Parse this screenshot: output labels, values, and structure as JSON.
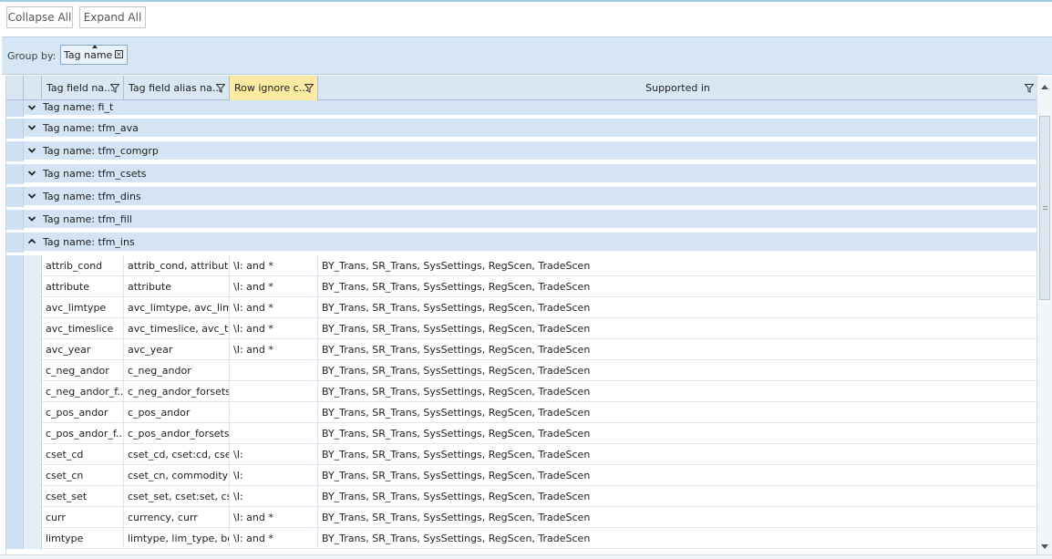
{
  "toolbar": {
    "collapse_all": "Collapse All",
    "expand_all": "Expand All"
  },
  "group_panel": {
    "label": "Group by:",
    "chip_label": "Tag name",
    "chip_close_glyph": "×"
  },
  "columns": [
    {
      "label": "Tag field na...",
      "filter_icon": "filter-icon"
    },
    {
      "label": "Tag field alias na...",
      "filter_icon": "filter-icon"
    },
    {
      "label": "Row ignore c...",
      "filter_icon": "filter-icon",
      "highlighted": true
    },
    {
      "label": "Supported in",
      "filter_icon": "filter-icon"
    }
  ],
  "groups": [
    {
      "label": "Tag name: fi_t",
      "expanded": false
    },
    {
      "label": "Tag name: tfm_ava",
      "expanded": false
    },
    {
      "label": "Tag name: tfm_comgrp",
      "expanded": false
    },
    {
      "label": "Tag name: tfm_csets",
      "expanded": false
    },
    {
      "label": "Tag name: tfm_dins",
      "expanded": false
    },
    {
      "label": "Tag name: tfm_fill",
      "expanded": false
    },
    {
      "label": "Tag name: tfm_ins",
      "expanded": true
    }
  ],
  "rows": [
    [
      "attrib_cond",
      "attrib_cond, attribut...",
      "\\I: and *",
      "BY_Trans, SR_Trans, SysSettings, RegScen, TradeScen"
    ],
    [
      "attribute",
      "attribute",
      "\\I: and *",
      "BY_Trans, SR_Trans, SysSettings, RegScen, TradeScen"
    ],
    [
      "avc_limtype",
      "avc_limtype, avc_lim...",
      "\\I: and *",
      "BY_Trans, SR_Trans, SysSettings, RegScen, TradeScen"
    ],
    [
      "avc_timeslice",
      "avc_timeslice, avc_ti...",
      "\\I: and *",
      "BY_Trans, SR_Trans, SysSettings, RegScen, TradeScen"
    ],
    [
      "avc_year",
      "avc_year",
      "\\I: and *",
      "BY_Trans, SR_Trans, SysSettings, RegScen, TradeScen"
    ],
    [
      "c_neg_andor",
      "c_neg_andor",
      "",
      "BY_Trans, SR_Trans, SysSettings, RegScen, TradeScen"
    ],
    [
      "c_neg_andor_f...",
      "c_neg_andor_forsets",
      "",
      "BY_Trans, SR_Trans, SysSettings, RegScen, TradeScen"
    ],
    [
      "c_pos_andor",
      "c_pos_andor",
      "",
      "BY_Trans, SR_Trans, SysSettings, RegScen, TradeScen"
    ],
    [
      "c_pos_andor_f...",
      "c_pos_andor_forsets",
      "",
      "BY_Trans, SR_Trans, SysSettings, RegScen, TradeScen"
    ],
    [
      "cset_cd",
      "cset_cd, cset:cd, cset...",
      "\\I:",
      "BY_Trans, SR_Trans, SysSettings, RegScen, TradeScen"
    ],
    [
      "cset_cn",
      "cset_cn, commodity,...",
      "\\I:",
      "BY_Trans, SR_Trans, SysSettings, RegScen, TradeScen"
    ],
    [
      "cset_set",
      "cset_set, cset:set, cs...",
      "\\I:",
      "BY_Trans, SR_Trans, SysSettings, RegScen, TradeScen"
    ],
    [
      "curr",
      "currency, curr",
      "\\I: and *",
      "BY_Trans, SR_Trans, SysSettings, RegScen, TradeScen"
    ],
    [
      "limtype",
      "limtype, lim_type, bd",
      "\\I: and *",
      "BY_Trans, SR_Trans, SysSettings, RegScen, TradeScen"
    ]
  ],
  "colors": {
    "header_bg": "#d9e7f5",
    "active_header": "#fbeaa0",
    "group_row": "#d4e4f5",
    "accent": "#9ecbe6"
  }
}
